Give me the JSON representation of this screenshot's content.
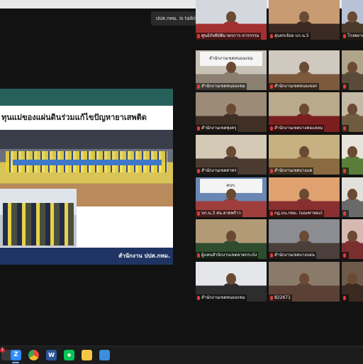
{
  "zoom": {
    "speaking_indicator": "ปปส.กทม. is talking..."
  },
  "shared_slide": {
    "title": "ทุนแม่ของแผ่นดินร่วมแก้ไขปัญหายาเสพติด",
    "footer": "สำนักงาน ปปส.กทม."
  },
  "gallery": {
    "tiles": [
      {
        "name": "สำนักงานเขตหนองแขม",
        "sign": "สำนักงานเขตหนองแขม"
      },
      {
        "name": "สำนักงานเขตหนองจอก",
        "sign": ""
      },
      {
        "name": "",
        "sign": ""
      },
      {
        "name": "สำนักงานเขตทุ่งครุ",
        "sign": ""
      },
      {
        "name": "สำนักงานเขตบางคอแหลม",
        "sign": ""
      },
      {
        "name": "",
        "sign": ""
      },
      {
        "name": "สำนักงานเขตสาทร",
        "sign": ""
      },
      {
        "name": "สำนักงานเขตบางแค",
        "sign": ""
      },
      {
        "name": "",
        "sign": ""
      },
      {
        "name": "บก.น.3 สน.ลาดพร้าว",
        "sign": "ตบก."
      },
      {
        "name": "กฎ.บน.กทม. (มณฑาทอง)",
        "sign": ""
      },
      {
        "name": "",
        "sign": ""
      },
      {
        "name": "ผู้แทนสำนักงานเขตลาดกระบัง",
        "sign": ""
      },
      {
        "name": "สำนักงานเขตบางบอน",
        "sign": ""
      },
      {
        "name": "",
        "sign": ""
      },
      {
        "name": "สำนักงานเขตหนองแขม",
        "sign": ""
      },
      {
        "name": "822671",
        "sign": ""
      },
      {
        "name": "",
        "sign": ""
      },
      {
        "name": "ศูนย์ภัยพิบัติมาตรการ-จารกรรม",
        "sign": ""
      },
      {
        "name": "สุนทรเจ้ยอ บก.น.5",
        "sign": ""
      },
      {
        "name": "โรงพยาบาล",
        "sign": ""
      }
    ]
  },
  "taskbar": {
    "apps": [
      {
        "name": "zoom",
        "color": "#2d8cff"
      },
      {
        "name": "chrome",
        "color": "#e8453c"
      },
      {
        "name": "word",
        "color": "#2b579a"
      },
      {
        "name": "line",
        "color": "#06c755"
      },
      {
        "name": "file-explorer",
        "color": "#f6c646"
      },
      {
        "name": "snipping-tool",
        "color": "#3c8dde"
      }
    ],
    "badge": "1"
  }
}
